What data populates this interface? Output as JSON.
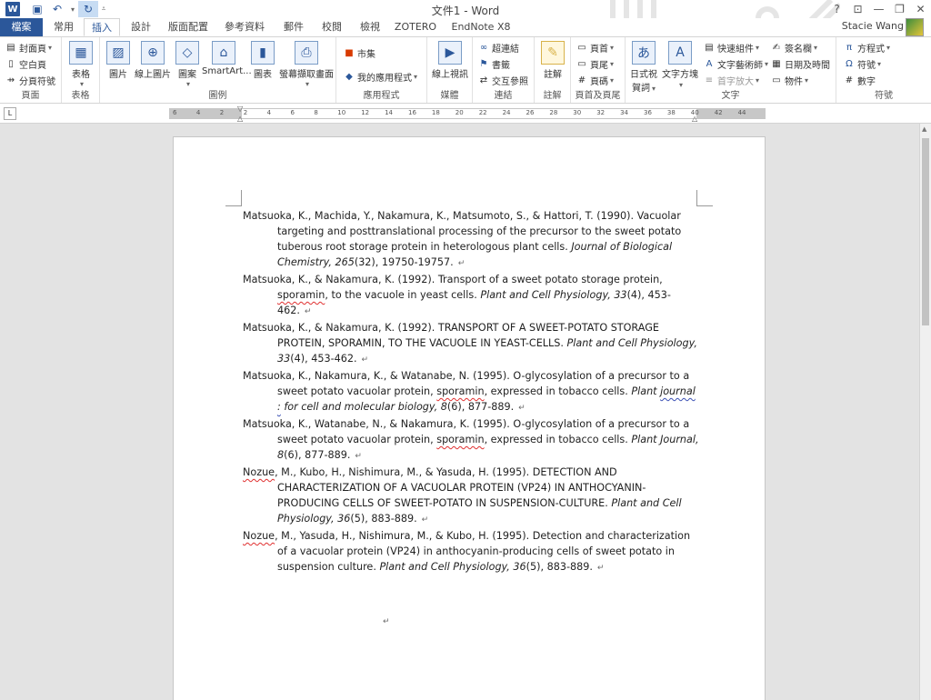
{
  "window": {
    "title": "文件1 - Word",
    "user": "Stacie Wang",
    "quick_access": {
      "save_icon": "save-icon",
      "undo_icon": "undo-icon",
      "redo_icon": "redo-icon"
    },
    "help": "?"
  },
  "tabs": [
    {
      "label": "檔案",
      "file": true
    },
    {
      "label": "常用"
    },
    {
      "label": "插入",
      "active": true
    },
    {
      "label": "設計"
    },
    {
      "label": "版面配置"
    },
    {
      "label": "參考資料"
    },
    {
      "label": "郵件"
    },
    {
      "label": "校閱"
    },
    {
      "label": "檢視"
    },
    {
      "label": "ZOTERO"
    },
    {
      "label": "EndNote X8"
    }
  ],
  "ribbon": {
    "pages": {
      "label": "頁面",
      "items": [
        "封面頁",
        "空白頁",
        "分頁符號"
      ]
    },
    "tables": {
      "label": "表格",
      "item": "表格"
    },
    "illustrations": {
      "label": "圖例",
      "items": [
        "圖片",
        "線上圖片",
        "圖案",
        "SmartArt...",
        "圖表",
        "螢幕擷取畫面"
      ]
    },
    "apps": {
      "label": "應用程式",
      "items": [
        "市集",
        "我的應用程式"
      ]
    },
    "media": {
      "label": "媒體",
      "item": "線上視訊"
    },
    "links": {
      "label": "連結",
      "items": [
        "超連結",
        "書籤",
        "交互參照"
      ]
    },
    "comments": {
      "label": "註解",
      "item": "註解"
    },
    "header_footer": {
      "label": "頁首及頁尾",
      "items": [
        "頁首",
        "頁尾",
        "頁碼"
      ]
    },
    "text": {
      "label": "文字",
      "items": [
        "日式祝賀詞",
        "文字方塊",
        "快速組件",
        "文字藝術師",
        "首字放大",
        "簽名欄",
        "日期及時間",
        "物件"
      ]
    },
    "symbols": {
      "label": "符號",
      "items": [
        "方程式",
        "符號",
        "數字"
      ]
    }
  },
  "ruler": {
    "ticks": [
      "6",
      "4",
      "2",
      "2",
      "4",
      "6",
      "8",
      "10",
      "12",
      "14",
      "16",
      "18",
      "20",
      "22",
      "24",
      "26",
      "28",
      "30",
      "32",
      "34",
      "36",
      "38",
      "40",
      "42",
      "44"
    ]
  },
  "document": {
    "paragraph_mark": "↵",
    "references": [
      {
        "plain1": "Matsuoka, K., Machida, Y., Nakamura, K., Matsumoto, S., & Hattori, T. (1990). Vacuolar targeting and posttranslational processing of the precursor to the sweet potato tuberous root storage protein in heterologous plant cells. ",
        "italic1": "Journal of Biological Chemistry, 265",
        "plain2": "(32), 19750-19757."
      },
      {
        "plain1": "Matsuoka, K., & Nakamura, K. (1992). Transport of a sweet potato storage protein, ",
        "sq1": "sporamin",
        "plain1b": ", to the vacuole in yeast cells. ",
        "italic1": "Plant and Cell Physiology, 33",
        "plain2": "(4), 453-462."
      },
      {
        "plain1": "Matsuoka, K., & Nakamura, K. (1992). TRANSPORT OF A SWEET-POTATO STORAGE PROTEIN, SPORAMIN, TO THE VACUOLE IN YEAST-CELLS. ",
        "italic1": "Plant and Cell Physiology, 33",
        "plain2": "(4), 453-462."
      },
      {
        "plain1": "Matsuoka, K., Nakamura, K., & Watanabe, N. (1995). O-glycosylation of a precursor to a sweet potato vacuolar protein, ",
        "sq1": "sporamin",
        "plain1b": ", expressed in tobacco cells. ",
        "italic1": "Plant ",
        "gu1": "journal :",
        "italic1b": " for cell and molecular biology, 8",
        "plain2": "(6), 877-889."
      },
      {
        "plain1": "Matsuoka, K., Watanabe, N., & Nakamura, K. (1995). O-glycosylation of a precursor to a sweet potato vacuolar protein, ",
        "sq1": "sporamin",
        "plain1b": ", expressed in tobacco cells. ",
        "italic1": "Plant Journal, 8",
        "plain2": "(6), 877-889."
      },
      {
        "sq0": "Nozue",
        "plain1": ", M., Kubo, H., Nishimura, M., & Yasuda, H. (1995). DETECTION AND CHARACTERIZATION OF A VACUOLAR PROTEIN (VP24) IN ANTHOCYANIN-PRODUCING CELLS OF SWEET-POTATO IN SUSPENSION-CULTURE. ",
        "italic1": "Plant and Cell Physiology, 36",
        "plain2": "(5), 883-889."
      },
      {
        "sq0": "Nozue",
        "plain1": ", M., Yasuda, H., Nishimura, M., & Kubo, H. (1995). Detection and characterization of a vacuolar protein (VP24) in anthocyanin-producing cells of sweet potato in suspension culture. ",
        "italic1": "Plant and Cell Physiology, 36",
        "plain2": "(5), 883-889."
      }
    ]
  }
}
